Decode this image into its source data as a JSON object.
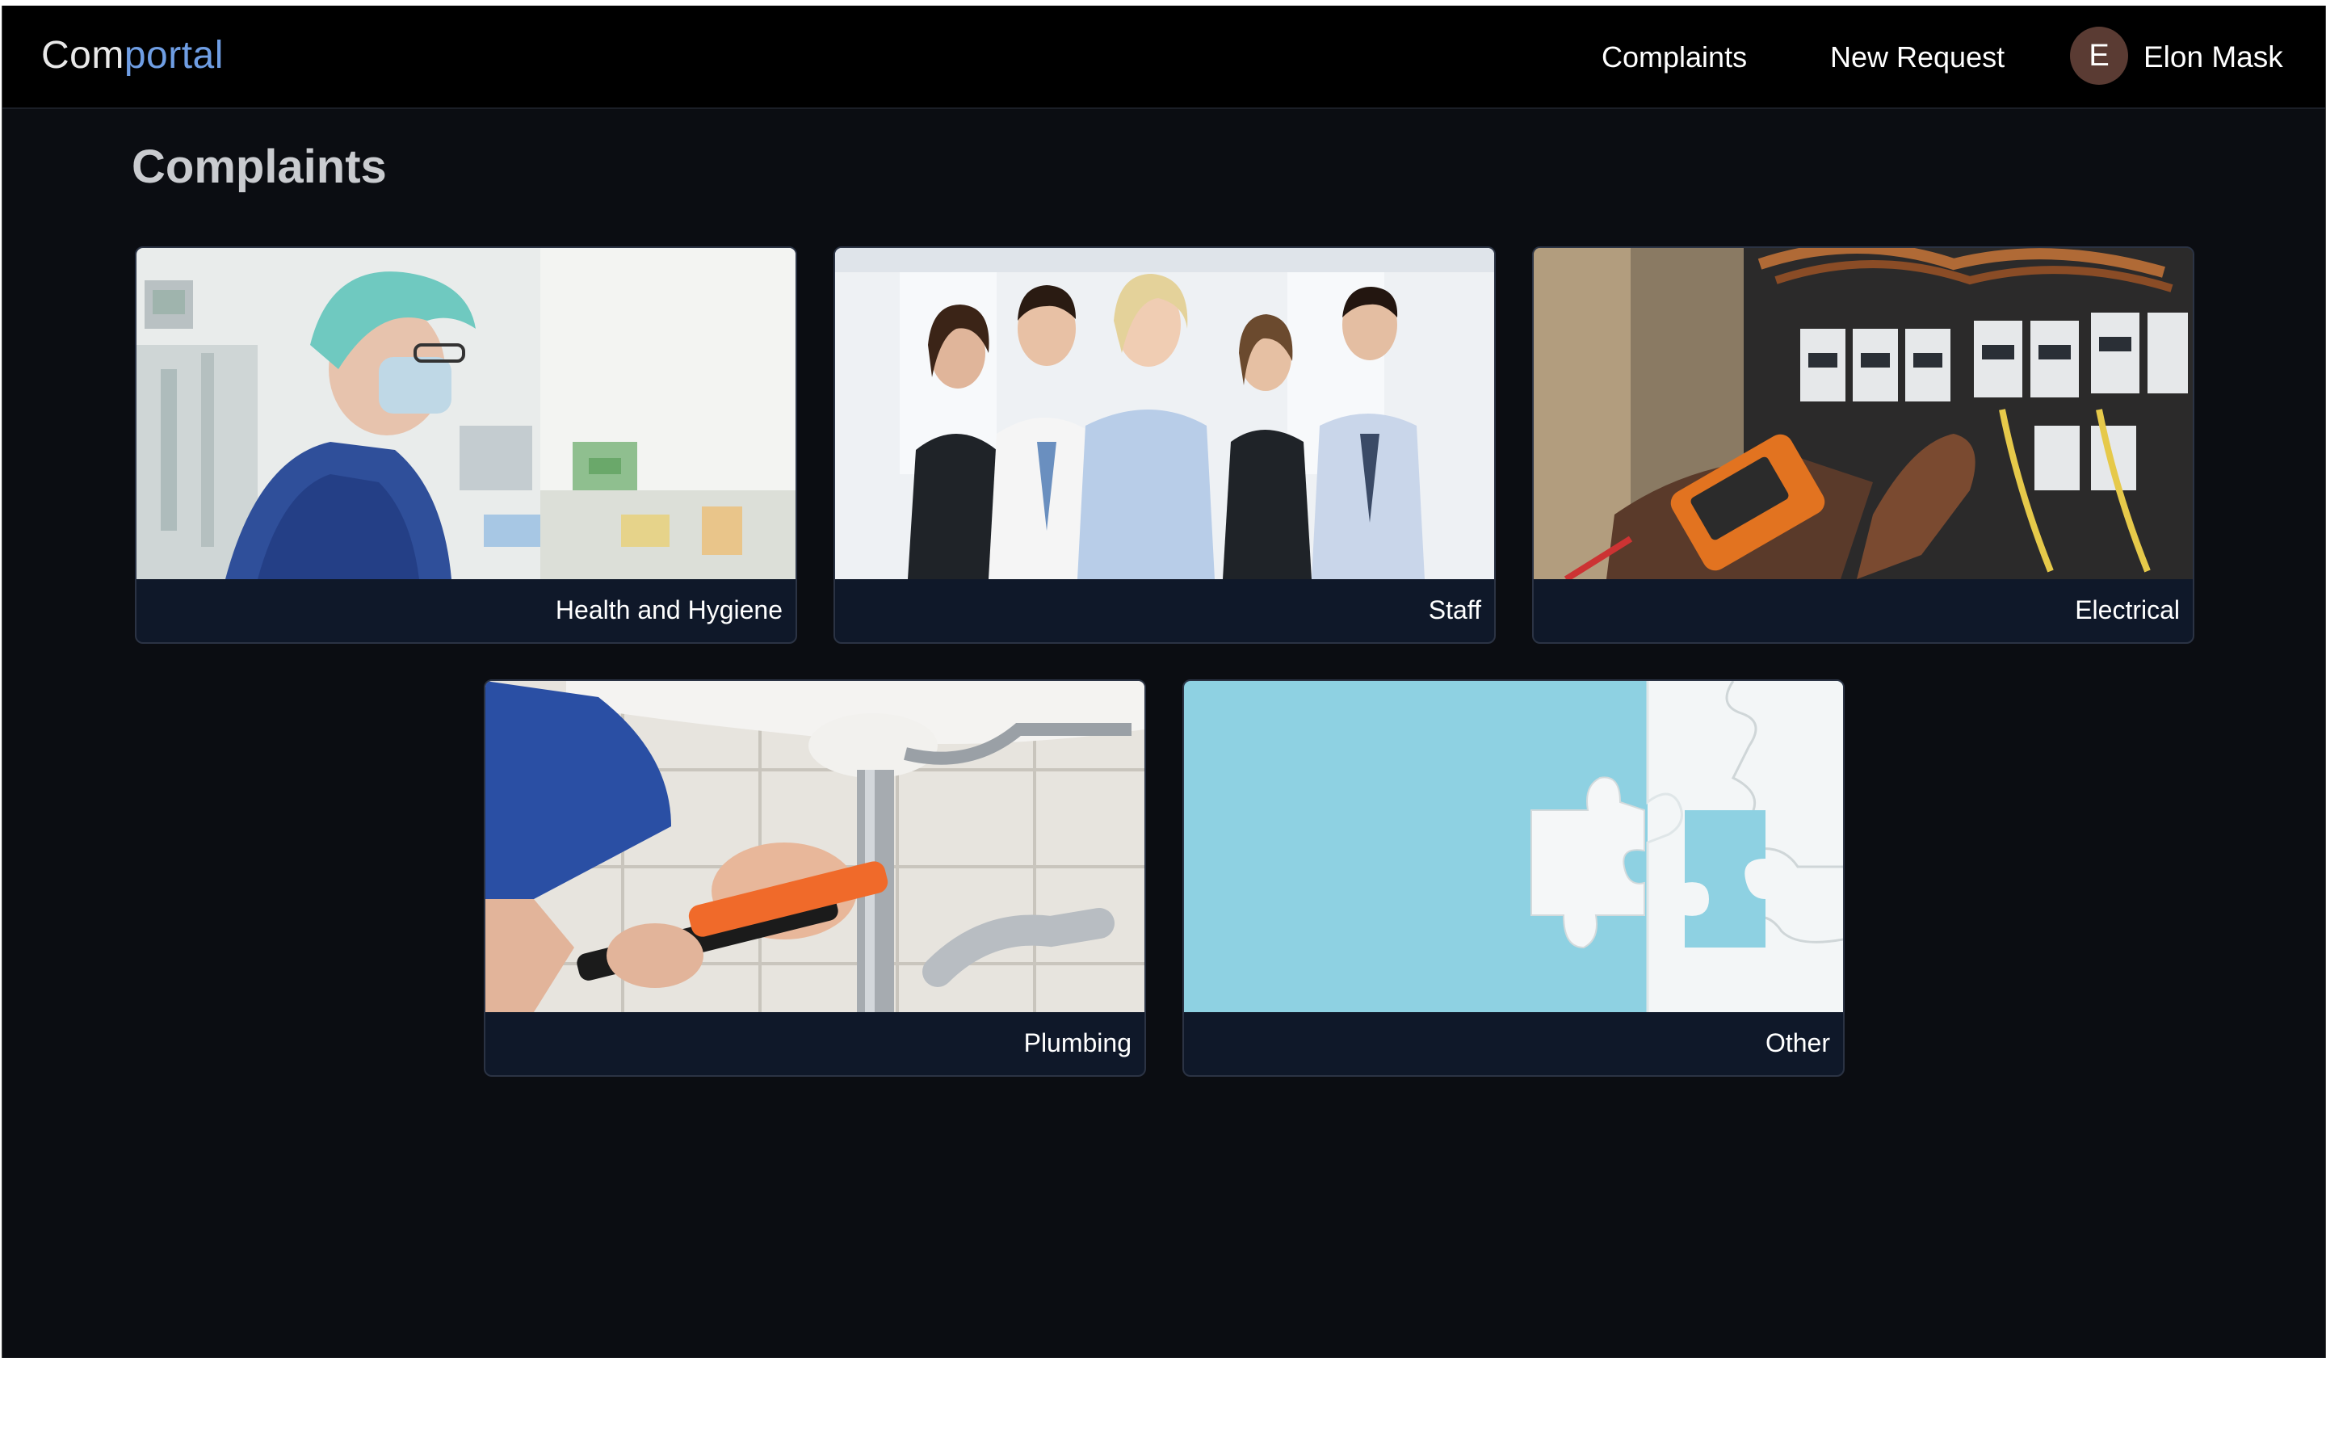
{
  "navbar": {
    "brand_prefix": "Com",
    "brand_accent": "portal",
    "links": [
      {
        "label": "Complaints"
      },
      {
        "label": "New Request"
      }
    ],
    "user": {
      "initial": "E",
      "name": "Elon Mask"
    }
  },
  "page": {
    "title": "Complaints"
  },
  "categories": [
    {
      "label": "Health and Hygiene",
      "image": "nurse-photo"
    },
    {
      "label": "Staff",
      "image": "team-photo"
    },
    {
      "label": "Electrical",
      "image": "electrician-photo"
    },
    {
      "label": "Plumbing",
      "image": "plumber-photo"
    },
    {
      "label": "Other",
      "image": "puzzle-photo"
    }
  ],
  "colors": {
    "page_bg": "#0b0d12",
    "navbar_bg": "#000000",
    "card_bg": "#0f1829",
    "brand_accent": "#6f9ee4",
    "avatar_bg": "#5a3b33"
  }
}
